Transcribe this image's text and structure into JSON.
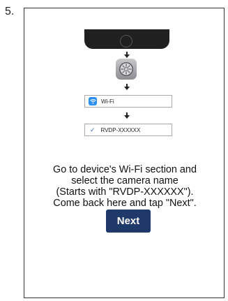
{
  "step_number": "5.",
  "settings_list": {
    "wifi_label": "Wi-Fi",
    "camera_label": "RVDP-XXXXXX"
  },
  "instructions": {
    "line1": "Go to device's Wi-Fi section and",
    "line2": "select the camera name",
    "line3": "(Starts with \"RVDP-XXXXXX\").",
    "line4": "Come back here and tap \"Next\"."
  },
  "next_button": {
    "label": "Next"
  },
  "colors": {
    "button": "#1f3a6a",
    "wifi_badge": "#2a8ff0",
    "check": "#2a6fd8"
  },
  "icons": [
    "phone-illustration",
    "down-arrow-icon",
    "settings-gear-icon",
    "wifi-icon",
    "checkmark-icon"
  ]
}
